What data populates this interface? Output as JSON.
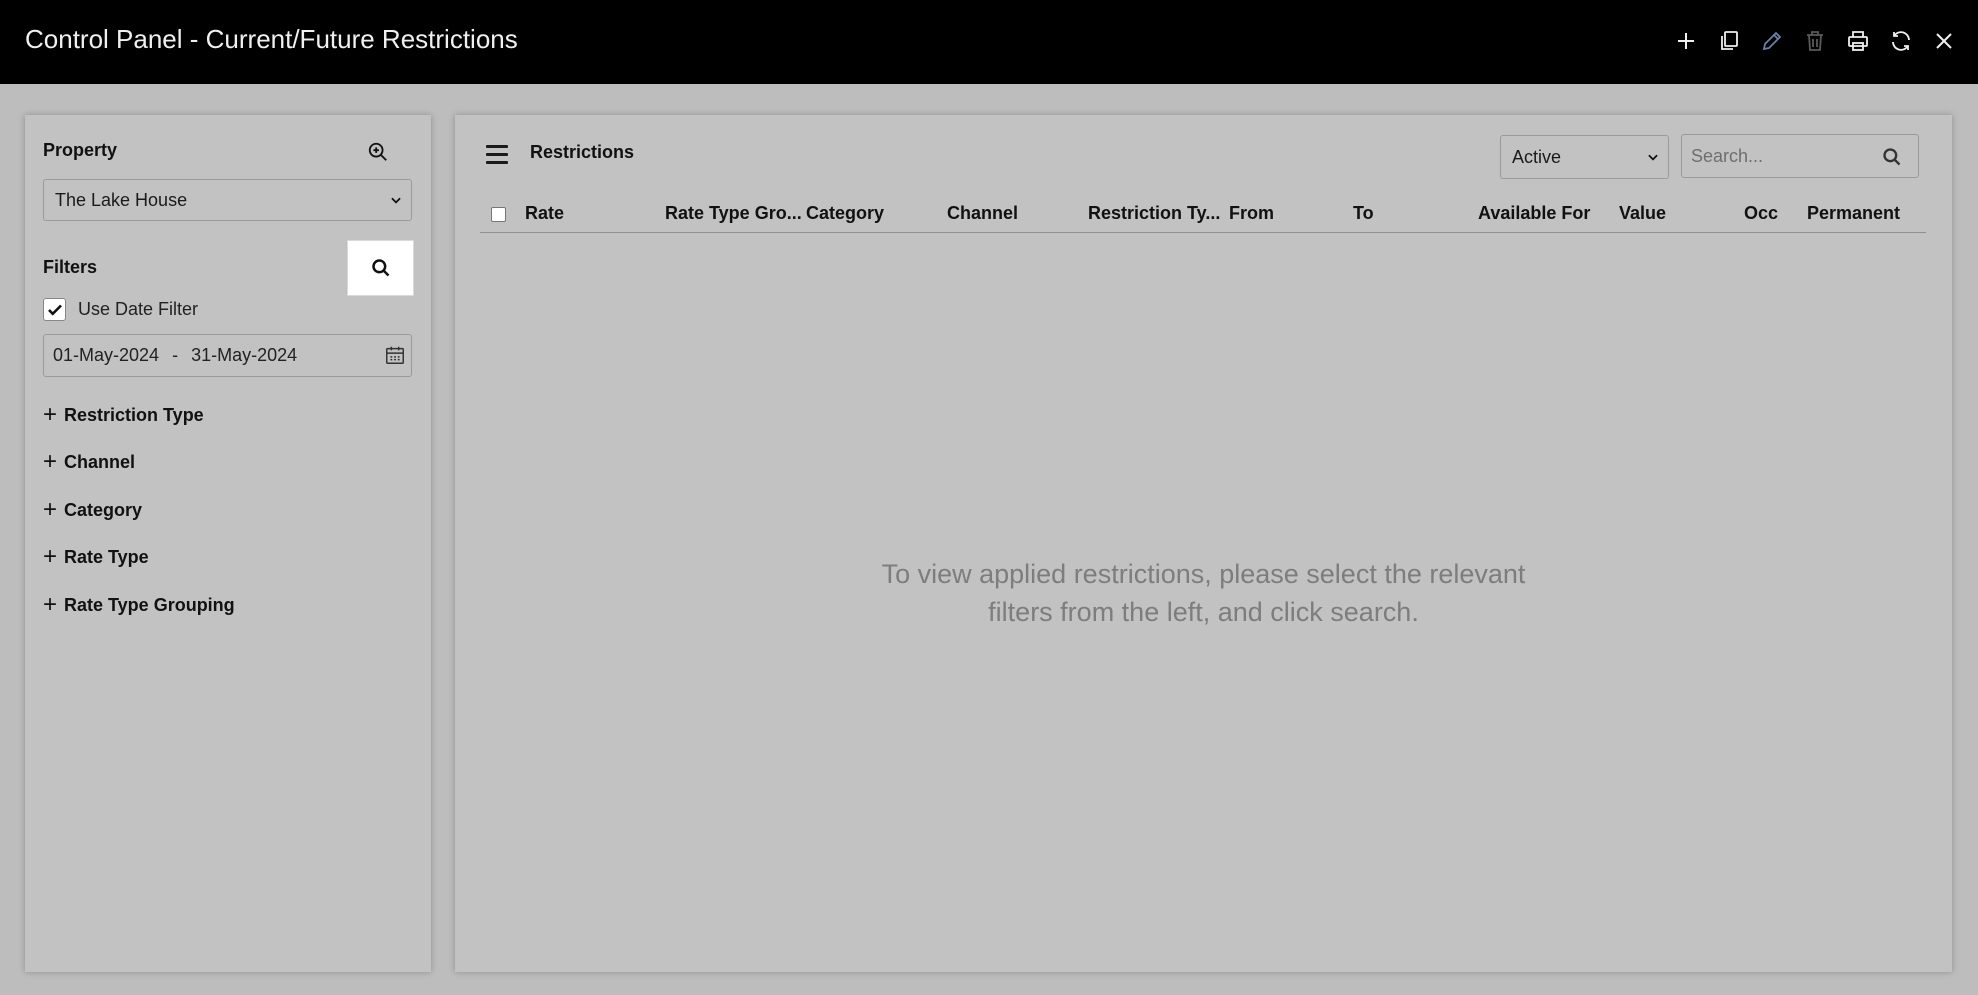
{
  "window": {
    "title": "Control Panel - Current/Future Restrictions",
    "toolbar": [
      "add-icon",
      "copy-icon",
      "edit-icon",
      "delete-icon",
      "print-icon",
      "refresh-icon",
      "close-icon"
    ]
  },
  "sidebar": {
    "property_label": "Property",
    "property_value": "The Lake House",
    "filters_label": "Filters",
    "use_date_filter_label": "Use Date Filter",
    "use_date_filter_checked": true,
    "date_from": "01-May-2024",
    "date_separator": "-",
    "date_to": "31-May-2024",
    "expanders": [
      {
        "label": "Restriction Type"
      },
      {
        "label": "Channel"
      },
      {
        "label": "Category"
      },
      {
        "label": "Rate Type"
      },
      {
        "label": "Rate Type Grouping"
      }
    ]
  },
  "main": {
    "title": "Restrictions",
    "status_value": "Active",
    "search_placeholder": "Search...",
    "columns": [
      "Rate",
      "Rate Type Gro...",
      "Category",
      "Channel",
      "Restriction Ty...",
      "From",
      "To",
      "Available For",
      "Value",
      "Occ",
      "Permanent"
    ],
    "empty_line1": "To view applied restrictions, please select the relevant",
    "empty_line2": "filters from the left, and click search."
  },
  "colors": {
    "titlebar": "#000000",
    "background": "#bdbdbd",
    "panel": "#c2c2c2",
    "edit_icon": "#6a7fa6",
    "empty_text": "#7d7d7d"
  }
}
